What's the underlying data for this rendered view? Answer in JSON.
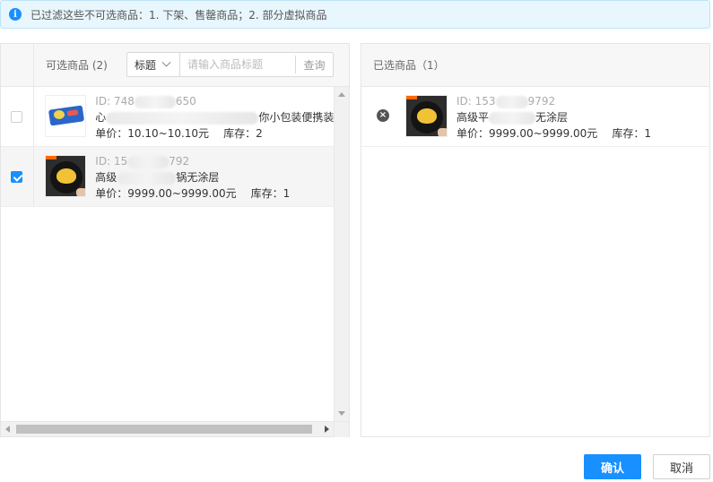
{
  "notice": {
    "icon": "info-icon",
    "text": "已过滤这些不可选商品：1. 下架、售罄商品；2. 部分虚拟商品"
  },
  "left": {
    "title": "可选商品 (2)",
    "search": {
      "field_selected": "标题",
      "placeholder": "请输入商品标题",
      "button": "查询"
    },
    "items": [
      {
        "checked": false,
        "id_start": "ID: 748",
        "id_end": "650",
        "name_start": "心",
        "name_end": "你小包装便携装",
        "price": "单价：10.10~10.10元",
        "stock": "库存：2"
      },
      {
        "checked": true,
        "id_start": "ID: 15",
        "id_end": "792",
        "name_start": "高级",
        "name_end": "锅无涂层",
        "price": "单价：9999.00~9999.00元",
        "stock": "库存：1"
      }
    ]
  },
  "right": {
    "title": "已选商品（1）",
    "items": [
      {
        "id_start": "ID: 153",
        "id_end": "9792",
        "name_start": "高级平",
        "name_end": "无涂层",
        "price": "单价：9999.00~9999.00元",
        "stock": "库存：1"
      }
    ]
  },
  "buttons": {
    "confirm": "确认",
    "cancel": "取消"
  },
  "colors": {
    "primary": "#1890ff",
    "notice_bg": "#e8f6fd"
  }
}
